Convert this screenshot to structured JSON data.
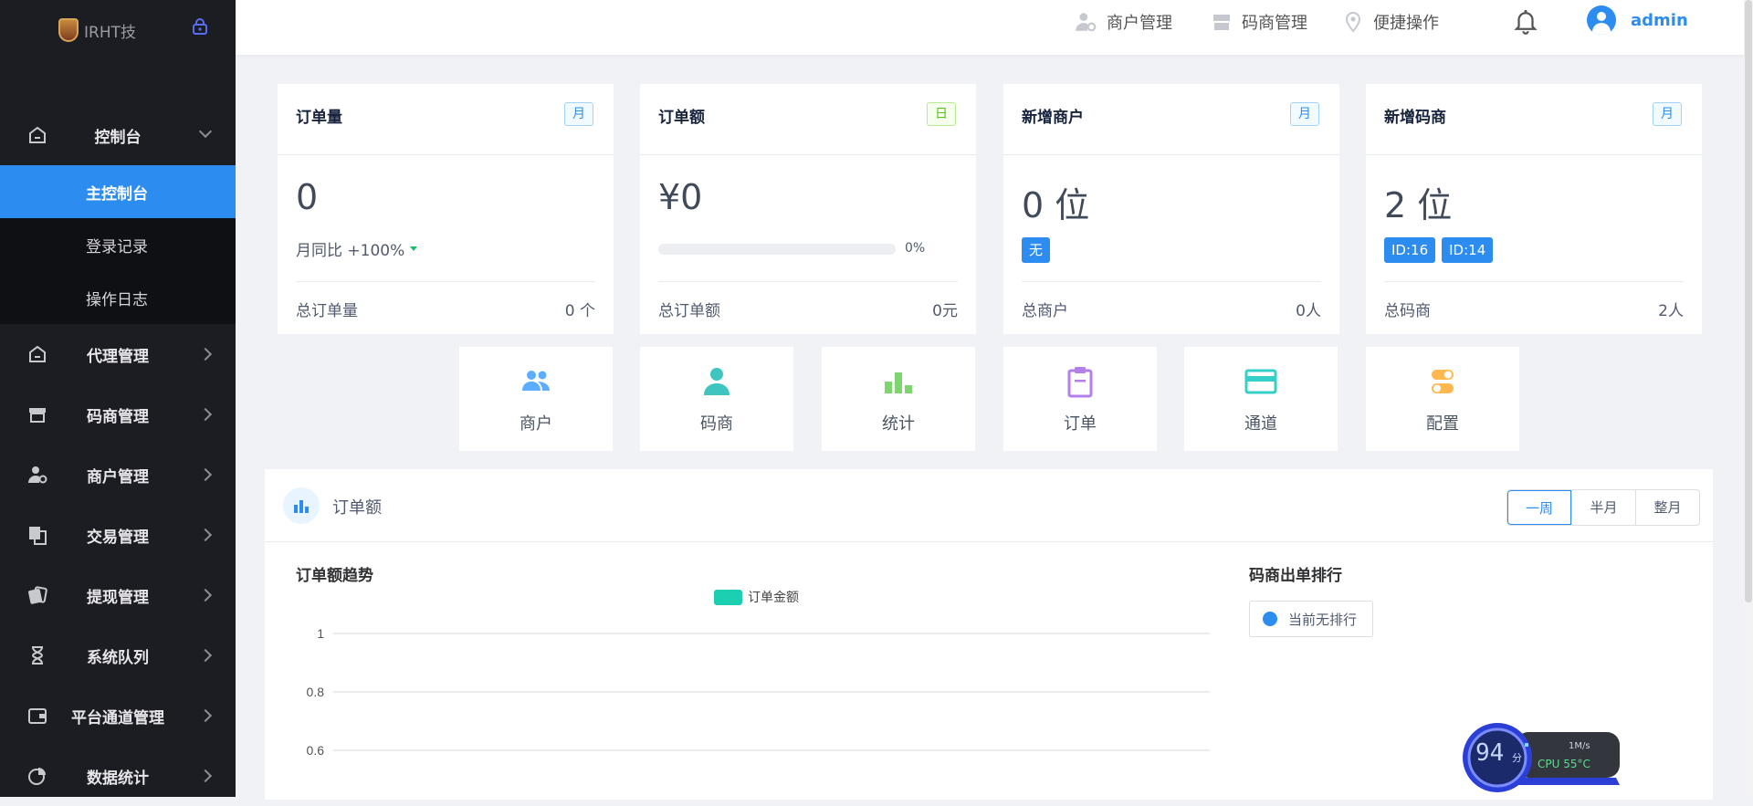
{
  "sidebar": {
    "logo_text": "IRHT技",
    "menu": [
      {
        "label": "控制台",
        "icon": "dashboard-icon",
        "open": true,
        "children": [
          {
            "label": "主控制台",
            "active": true
          },
          {
            "label": "登录记录",
            "active": false
          },
          {
            "label": "操作日志",
            "active": false
          }
        ]
      },
      {
        "label": "代理管理",
        "icon": "dashboard-icon"
      },
      {
        "label": "码商管理",
        "icon": "store-icon"
      },
      {
        "label": "商户管理",
        "icon": "user-gear-icon"
      },
      {
        "label": "交易管理",
        "icon": "transaction-icon"
      },
      {
        "label": "提现管理",
        "icon": "withdraw-icon"
      },
      {
        "label": "系统队列",
        "icon": "hourglass-icon"
      },
      {
        "label": "平台通道管理",
        "icon": "wallet-icon"
      },
      {
        "label": "数据统计",
        "icon": "pie-chart-icon"
      }
    ]
  },
  "topbar": {
    "nav": [
      {
        "label": "商户管理",
        "icon": "user-gear-icon"
      },
      {
        "label": "码商管理",
        "icon": "store-icon"
      },
      {
        "label": "便捷操作",
        "icon": "location-icon"
      }
    ],
    "username": "admin"
  },
  "cards": [
    {
      "title": "订单量",
      "tag": "月",
      "tag_color": "#2d8cf0",
      "value": "0",
      "compare": "月同比 +100%",
      "foot_label": "总订单量",
      "foot_value": "0 个"
    },
    {
      "title": "订单额",
      "tag": "日",
      "tag_color": "#52c41a",
      "value": "¥0",
      "progress": 0,
      "progress_text": "0%",
      "foot_label": "总订单额",
      "foot_value": "0元"
    },
    {
      "title": "新增商户",
      "tag": "月",
      "tag_color": "#2d8cf0",
      "value": "0 位",
      "badges": [
        "无"
      ],
      "foot_label": "总商户",
      "foot_value": "0人"
    },
    {
      "title": "新增码商",
      "tag": "月",
      "tag_color": "#2d8cf0",
      "value": "2 位",
      "badges": [
        "ID:16",
        "ID:14"
      ],
      "foot_label": "总码商",
      "foot_value": "2人"
    }
  ],
  "shortcuts": [
    {
      "label": "商户",
      "icon": "users-icon",
      "color": "#5cadff"
    },
    {
      "label": "码商",
      "icon": "user-icon",
      "color": "#3ec5c0"
    },
    {
      "label": "统计",
      "icon": "bar-chart-icon",
      "color": "#7ed56f"
    },
    {
      "label": "订单",
      "icon": "clipboard-icon",
      "color": "#b37feb"
    },
    {
      "label": "通道",
      "icon": "card-icon",
      "color": "#36cfc9"
    },
    {
      "label": "配置",
      "icon": "toggle-icon",
      "color": "#ffb84d"
    }
  ],
  "panel": {
    "title": "订单额",
    "periods": [
      "一周",
      "半月",
      "整月"
    ],
    "active_period": "一周",
    "chart_title": "订单额趋势",
    "ranking_title": "码商出单排行",
    "ranking_empty": "当前无排行"
  },
  "chart_data": {
    "type": "line",
    "title": "订单额趋势",
    "series": [
      {
        "name": "订单金额",
        "values": []
      }
    ],
    "y_ticks": [
      1,
      0.8,
      0.6
    ],
    "ylim": [
      0,
      1
    ],
    "grid": true,
    "legend": "top-center",
    "color": "#1bcfb0"
  },
  "widget": {
    "score": "94",
    "unit": "分",
    "speed": "1M/s",
    "cpu": "CPU 55°C"
  }
}
